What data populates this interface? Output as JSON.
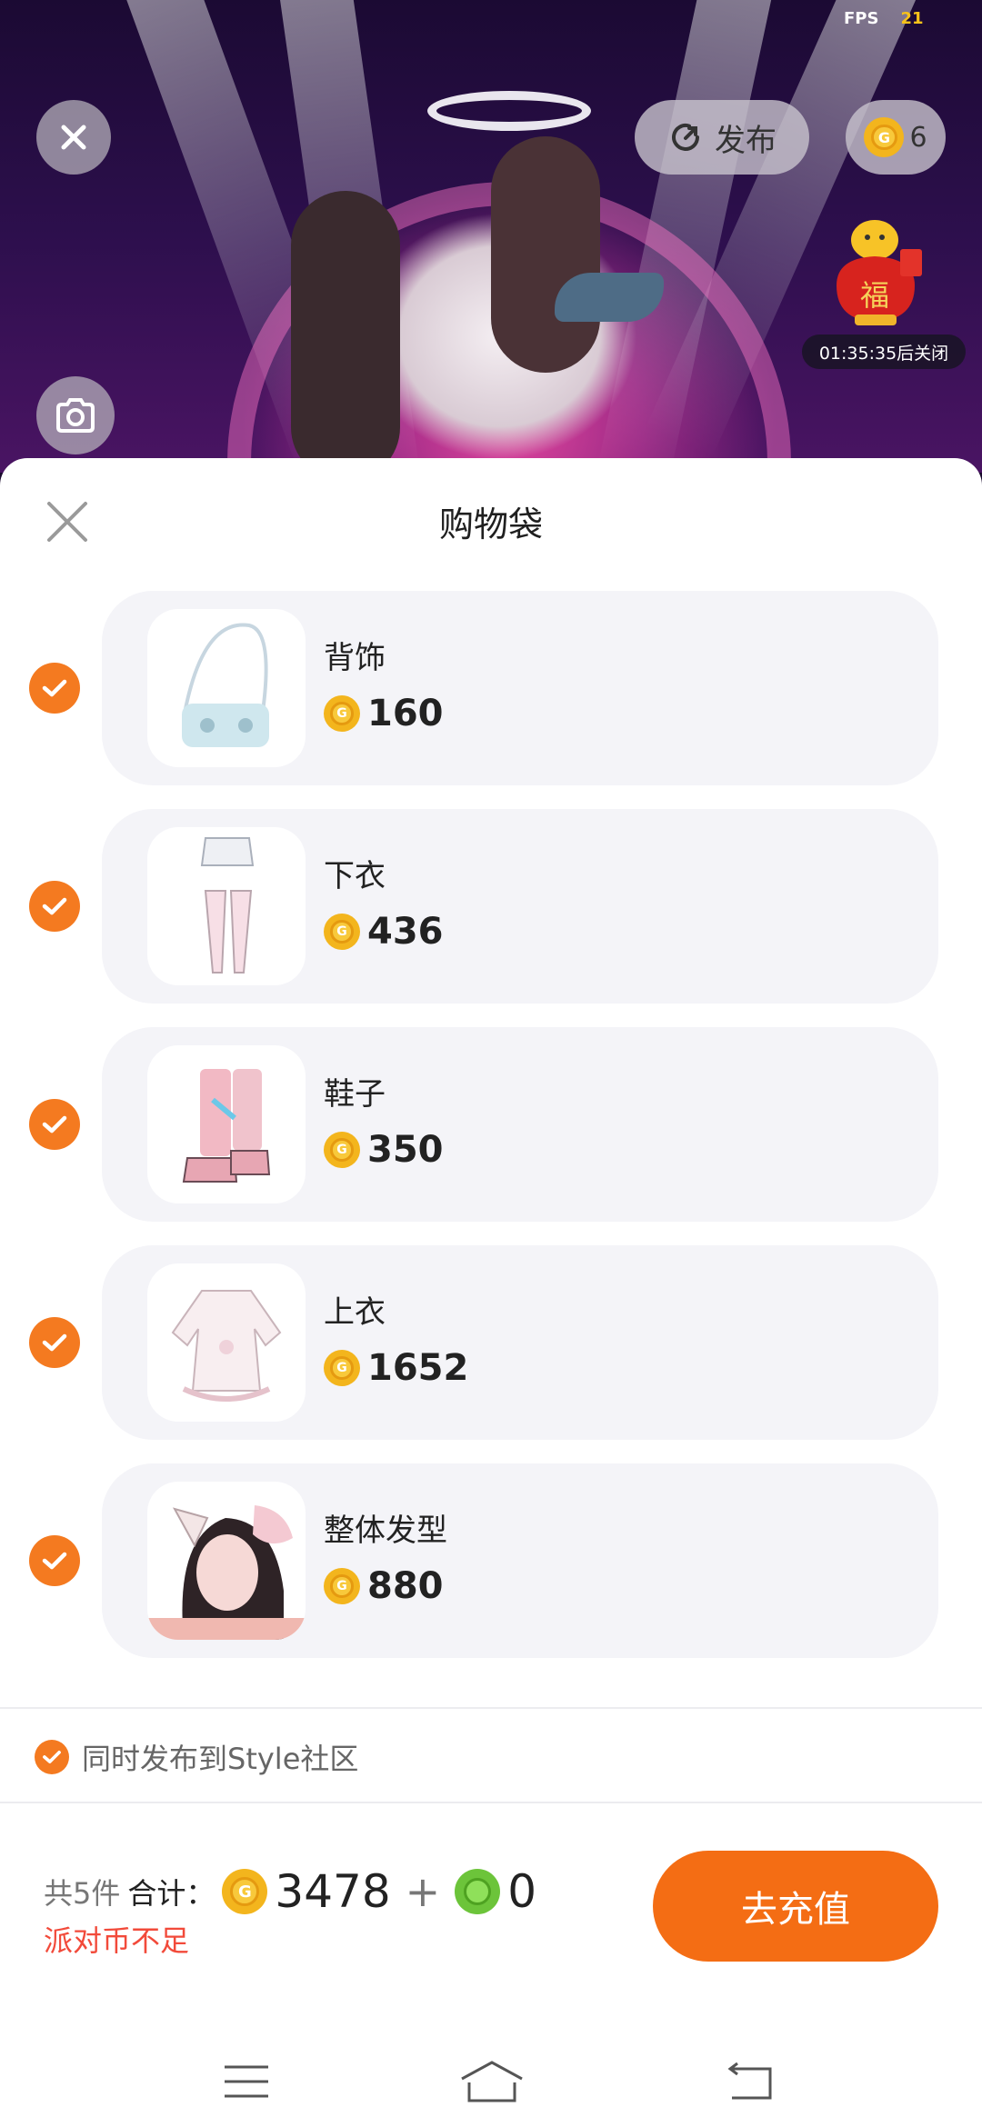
{
  "overlay": {
    "fps_label": "FPS",
    "fps_value": "21",
    "publish_label": "发布",
    "coin_count": "6",
    "timer_text": "01:35:35后关闭",
    "gift_badge_char": "福"
  },
  "sheet": {
    "title": "购物袋",
    "items": [
      {
        "name": "背饰",
        "price": "160"
      },
      {
        "name": "下衣",
        "price": "436"
      },
      {
        "name": "鞋子",
        "price": "350"
      },
      {
        "name": "上衣",
        "price": "1652"
      },
      {
        "name": "整体发型",
        "price": "880"
      }
    ],
    "publish_option_label": "同时发布到Style社区"
  },
  "footer": {
    "count_text": "共5件",
    "total_label": "合计：",
    "coin_total": "3478",
    "plus": "+",
    "gcoin_total": "0",
    "warning": "派对币不足",
    "recharge_label": "去充值"
  },
  "colors": {
    "accent": "#f46d14",
    "check": "#f47a20",
    "warning": "#f24a3a",
    "card_bg": "#f4f4f8",
    "coin_gold": "#f3b51d",
    "coin_green": "#6cc43a"
  },
  "icons": [
    "close-icon",
    "camera-icon",
    "publish-refresh-icon",
    "gold-coin-icon",
    "green-coin-icon",
    "check-icon",
    "menu-icon",
    "home-icon",
    "back-icon"
  ]
}
